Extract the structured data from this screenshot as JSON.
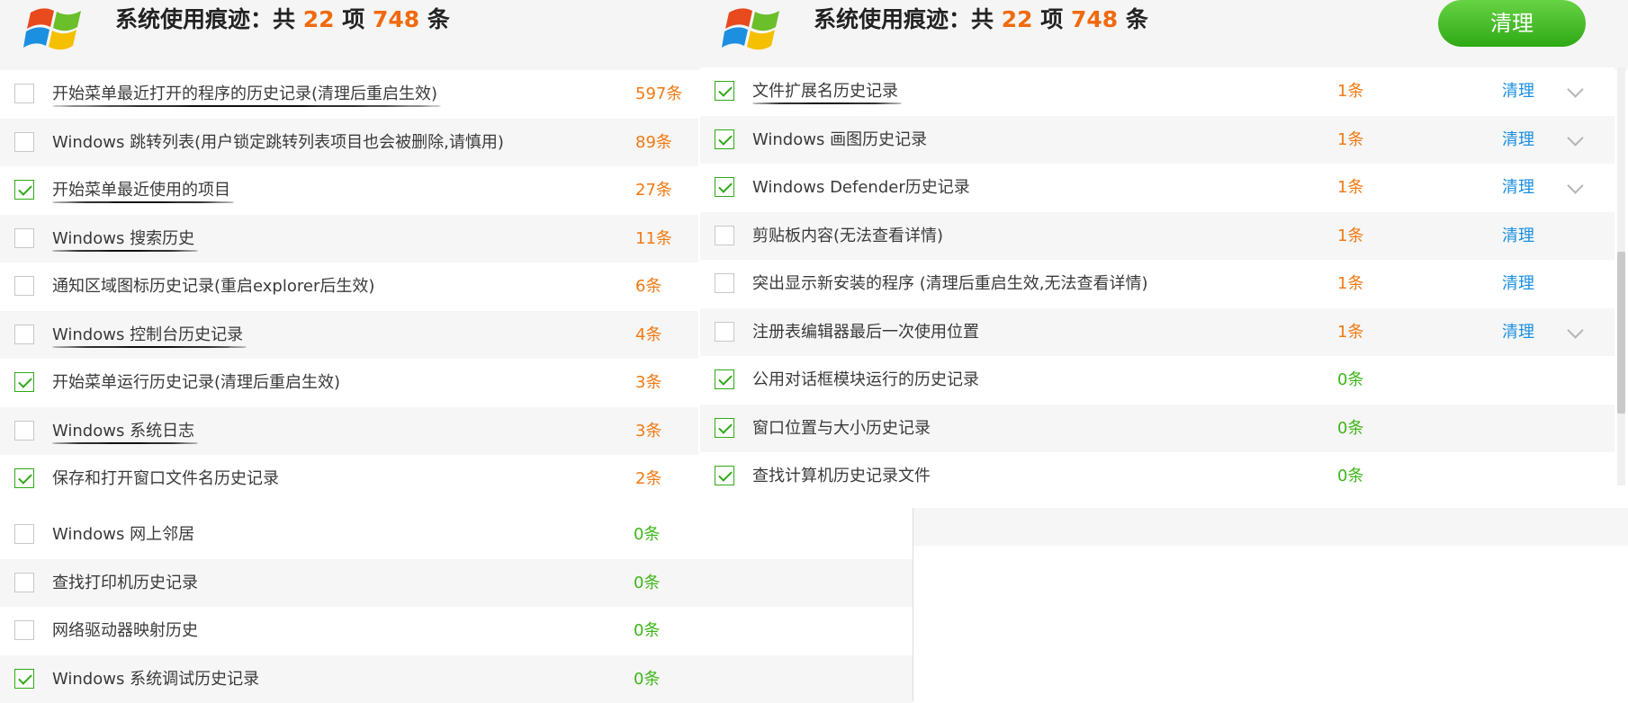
{
  "header": {
    "prefix": "系统使用痕迹：共",
    "items_count": "22",
    "items_unit": "项",
    "entries_count": "748",
    "entries_unit": "条",
    "clean_button": "清理",
    "logo_icon": "windows-logo-icon"
  },
  "colors": {
    "accent_orange": "#f07a14",
    "accent_green": "#3fb61a",
    "link_blue": "#1a8fe0",
    "button_green": "#2fa916"
  },
  "left_items": [
    {
      "label": "开始菜单最近打开的程序的历史记录(清理后重启生效)",
      "count": "597条",
      "checked": false
    },
    {
      "label": "Windows 跳转列表(用户锁定跳转列表项目也会被删除,请慎用)",
      "count": "89条",
      "checked": false
    },
    {
      "label": "开始菜单最近使用的项目",
      "count": "27条",
      "checked": true
    },
    {
      "label": "Windows 搜索历史",
      "count": "11条",
      "checked": false
    },
    {
      "label": "通知区域图标历史记录(重启explorer后生效)",
      "count": "6条",
      "checked": false
    },
    {
      "label": "Windows 控制台历史记录",
      "count": "4条",
      "checked": false
    },
    {
      "label": "开始菜单运行历史记录(清理后重启生效)",
      "count": "3条",
      "checked": true
    },
    {
      "label": "Windows 系统日志",
      "count": "3条",
      "checked": false
    },
    {
      "label": "保存和打开窗口文件名历史记录",
      "count": "2条",
      "checked": true
    }
  ],
  "lower_items": [
    {
      "label": "Windows 网上邻居",
      "count": "0条",
      "checked": false
    },
    {
      "label": "查找打印机历史记录",
      "count": "0条",
      "checked": false
    },
    {
      "label": "网络驱动器映射历史",
      "count": "0条",
      "checked": false
    },
    {
      "label": "Windows 系统调试历史记录",
      "count": "0条",
      "checked": true
    }
  ],
  "right_items": [
    {
      "label": "文件扩展名历史记录",
      "count": "1条",
      "checked": true,
      "clean": "清理",
      "expand": true
    },
    {
      "label": "Windows 画图历史记录",
      "count": "1条",
      "checked": true,
      "clean": "清理",
      "expand": true
    },
    {
      "label": "Windows Defender历史记录",
      "count": "1条",
      "checked": true,
      "clean": "清理",
      "expand": true
    },
    {
      "label": "剪贴板内容(无法查看详情)",
      "count": "1条",
      "checked": false,
      "clean": "清理",
      "expand": false
    },
    {
      "label": "突出显示新安装的程序 (清理后重启生效,无法查看详情)",
      "count": "1条",
      "checked": false,
      "clean": "清理",
      "expand": false
    },
    {
      "label": "注册表编辑器最后一次使用位置",
      "count": "1条",
      "checked": false,
      "clean": "清理",
      "expand": true
    },
    {
      "label": "公用对话框模块运行的历史记录",
      "count": "0条",
      "checked": true,
      "clean": "",
      "expand": false
    },
    {
      "label": "窗口位置与大小历史记录",
      "count": "0条",
      "checked": true,
      "clean": "",
      "expand": false
    },
    {
      "label": "查找计算机历史记录文件",
      "count": "0条",
      "checked": true,
      "clean": "",
      "expand": false
    }
  ]
}
